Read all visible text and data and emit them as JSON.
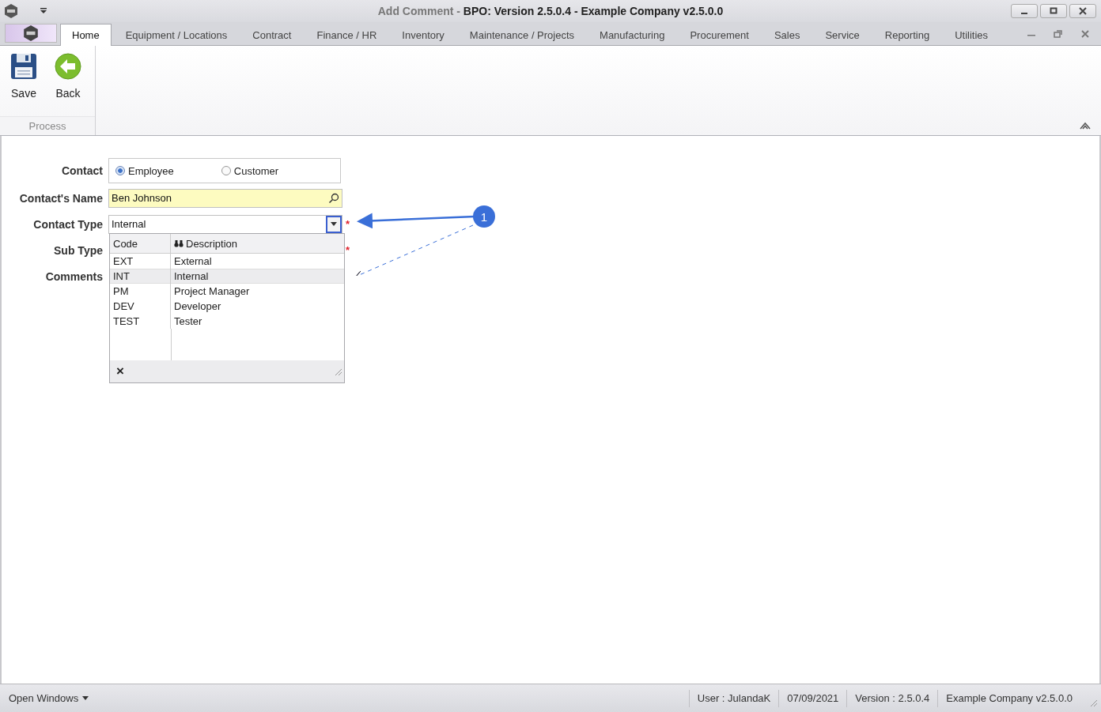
{
  "window": {
    "title_document": "Add Comment -",
    "title_application": "BPO: Version 2.5.0.4 - Example Company v2.5.0.0"
  },
  "tabs": [
    {
      "label": "Home",
      "selected": true
    },
    {
      "label": "Equipment / Locations",
      "selected": false
    },
    {
      "label": "Contract",
      "selected": false
    },
    {
      "label": "Finance / HR",
      "selected": false
    },
    {
      "label": "Inventory",
      "selected": false
    },
    {
      "label": "Maintenance / Projects",
      "selected": false
    },
    {
      "label": "Manufacturing",
      "selected": false
    },
    {
      "label": "Procurement",
      "selected": false
    },
    {
      "label": "Sales",
      "selected": false
    },
    {
      "label": "Service",
      "selected": false
    },
    {
      "label": "Reporting",
      "selected": false
    },
    {
      "label": "Utilities",
      "selected": false
    }
  ],
  "ribbon": {
    "buttons": [
      {
        "label": "Save",
        "kind": "save"
      },
      {
        "label": "Back",
        "kind": "back"
      }
    ],
    "group_label": "Process"
  },
  "form": {
    "contact_label": "Contact",
    "contact_options": [
      {
        "label": "Employee",
        "selected": true
      },
      {
        "label": "Customer",
        "selected": false
      }
    ],
    "name_label": "Contact's Name",
    "name_value": "Ben Johnson",
    "type_label": "Contact Type",
    "type_value": "Internal",
    "type_required": "*",
    "subtype_label": "Sub Type",
    "subtype_required": "*",
    "comments_label": "Comments"
  },
  "dropdown": {
    "columns": [
      "Code",
      "Description"
    ],
    "rows": [
      {
        "code": "EXT",
        "description": "External",
        "selected": false
      },
      {
        "code": "INT",
        "description": "Internal",
        "selected": true
      },
      {
        "code": "PM",
        "description": "Project Manager",
        "selected": false
      },
      {
        "code": "DEV",
        "description": "Developer",
        "selected": false
      },
      {
        "code": "TEST",
        "description": "Tester",
        "selected": false
      }
    ],
    "close": "×"
  },
  "annotation": {
    "number": "1"
  },
  "status_bar": {
    "open_windows": "Open Windows",
    "items": [
      "User : JulandaK",
      "07/09/2021",
      "Version : 2.5.0.4",
      "Example Company v2.5.0.0"
    ]
  }
}
